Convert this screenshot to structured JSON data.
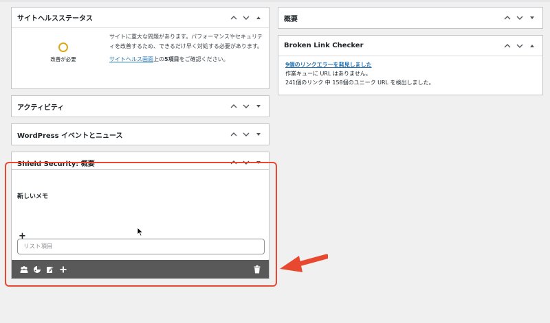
{
  "site_health": {
    "title": "サイトヘルスステータス",
    "status": "改善が必要",
    "description": "サイトに重大な問題があります。パフォーマンスやセキュリティを改善するため、できるだけ早く対処する必要があります。",
    "link_text": "サイトヘルス画面",
    "tail_before": "上の",
    "count_text": "5項目",
    "tail_after": "をご確認ください。",
    "status_color": "#dba617"
  },
  "activity": {
    "title": "アクティビティ"
  },
  "events": {
    "title": "WordPress イベントとニュース"
  },
  "shield": {
    "title": "Shield Security: 概要"
  },
  "overview": {
    "title": "概要"
  },
  "blc": {
    "title": "Broken Link Checker",
    "errors_link": "9個のリンクエラーを発見しました",
    "queue_text": "作業キューに URL はありません。",
    "summary_text": "241個のリンク 中 158個のユニーク URL を検出しました。"
  },
  "note": {
    "title": "新しいメモ",
    "add_symbol": "+",
    "input_placeholder": "リスト項目",
    "toolbar_icons": [
      "users-icon",
      "color-palette-icon",
      "edit-note-icon",
      "add-icon",
      "trash-icon"
    ],
    "toolbar_color": "#595959"
  },
  "annotation": {
    "highlight_color": "#e8482f"
  }
}
